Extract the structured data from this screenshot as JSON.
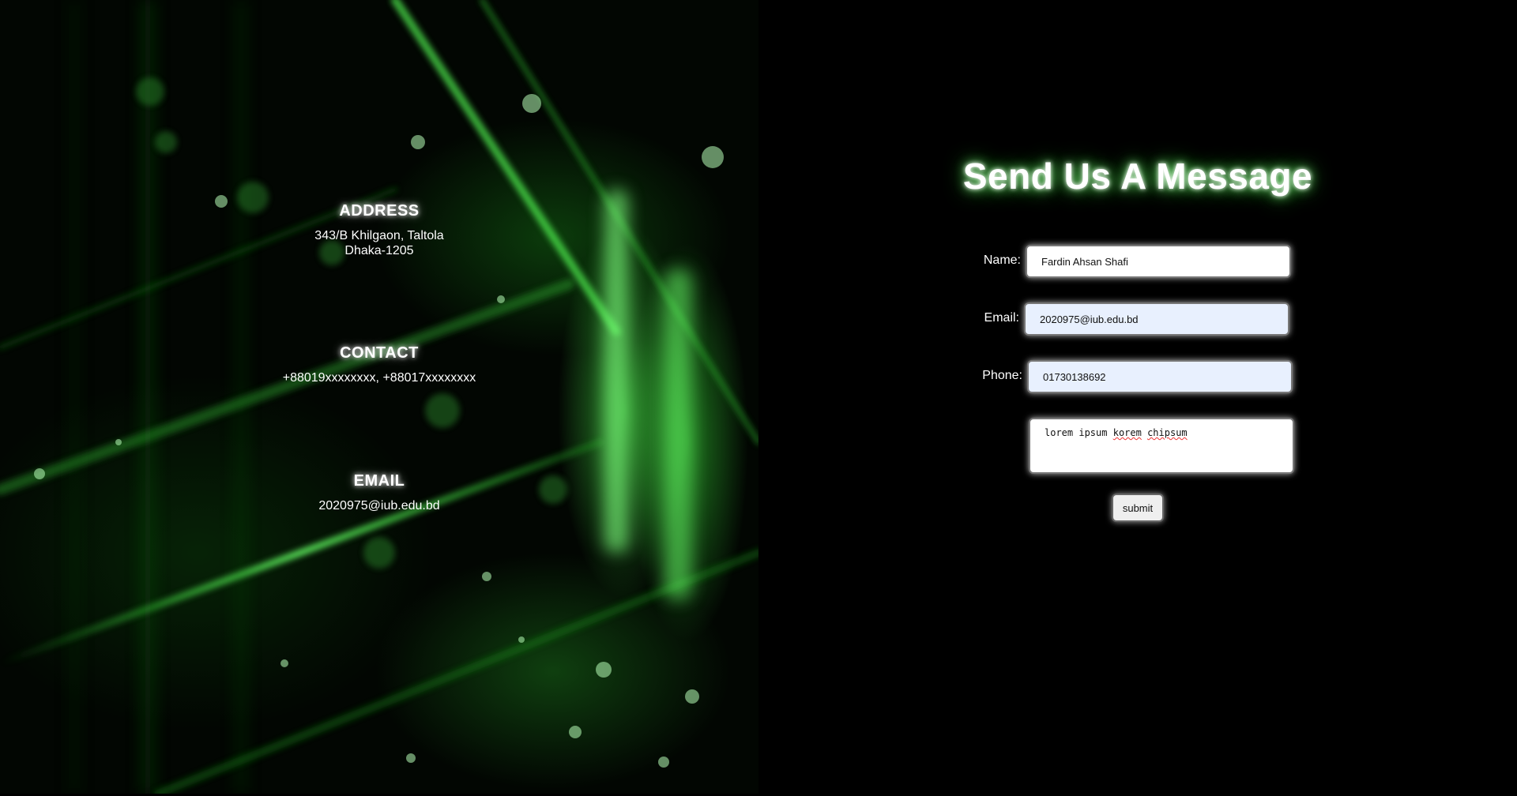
{
  "info": {
    "address": {
      "heading": "ADDRESS",
      "line1": "343/B Khilgaon, Taltola",
      "line2": "Dhaka-1205"
    },
    "contact": {
      "heading": "CONTACT",
      "text": "+88019xxxxxxxx, +88017xxxxxxxx"
    },
    "email": {
      "heading": "EMAIL",
      "text": "2020975@iub.edu.bd"
    }
  },
  "form": {
    "title": "Send Us A Message",
    "name": {
      "label": "Name:",
      "value": "Fardin Ahsan Shafi"
    },
    "email": {
      "label": "Email:",
      "value": "2020975@iub.edu.bd"
    },
    "phone": {
      "label": "Phone:",
      "value": "01730138692"
    },
    "message": {
      "words": [
        "lorem",
        "ipsum",
        "korem",
        "chipsum"
      ]
    },
    "submit_label": "submit"
  },
  "colors": {
    "background": "#000000",
    "accent_glow": "#3cff3c",
    "autofill_bg": "#e8f0fe"
  }
}
